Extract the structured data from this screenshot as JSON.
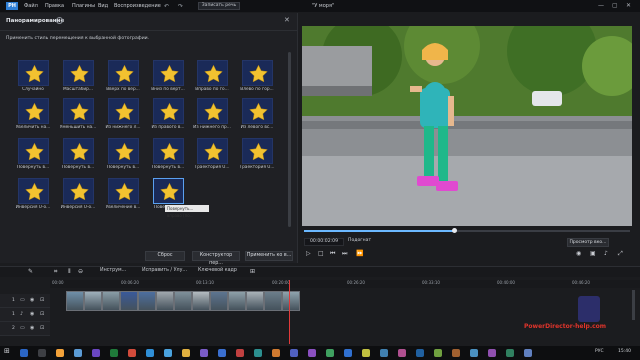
{
  "menu": [
    "Файл",
    "Правка",
    "Плагины",
    "Вид",
    "Воспроизведение"
  ],
  "record_btn": "Записать речь",
  "project_title": "\"У моря\"",
  "panel": {
    "title": "Панорамирование",
    "subtitle": "Применить стиль перемещения к выбранной фотографии.",
    "tooltip": "Повернуть... вправо (по...",
    "effects": [
      "Случайно",
      "Масштабир...",
      "Вверх по вер...",
      "Вниз по верт...",
      "Вправо по го...",
      "Влево по гор...",
      "Увеличить на...",
      "Уменьшить на...",
      "Из нижнего л...",
      "Из правого в...",
      "Из нижнего пр...",
      "Из левого вс...",
      "Повернуть в...",
      "Повернуть в...",
      "Повернуть в...",
      "Повернуть в...",
      "Траектория U...",
      "Траектория U...",
      "Инверсия U-о...",
      "Инверсия U-о...",
      "Увеличение в...",
      "Повернуть..."
    ],
    "buttons": {
      "reset": "Сброс",
      "constructor": "Конструктор пер...",
      "apply_all": "Применить ко в..."
    }
  },
  "preview": {
    "timecode": "00:00:02:09",
    "fit_label": "Подогнат",
    "snapshot_btn": "Просмотр вко..."
  },
  "toolbar": {
    "tools_label": "Инструм...",
    "fix_label": "Исправить / Улу...",
    "keyframe_label": "Ключевой кадр"
  },
  "ruler": [
    "00:00",
    "00:06:20",
    "00:13:10",
    "00:20:00",
    "00:26:20",
    "00:33:10",
    "00:40:00",
    "00:46:20"
  ],
  "tracks": [
    {
      "index": "1",
      "name": "video"
    },
    {
      "index": "1",
      "name": "audio"
    },
    {
      "index": "2",
      "name": "video"
    }
  ],
  "taskbar": {
    "lang": "РУС",
    "time": "15:40"
  },
  "watermark": "PowerDirector-help.com",
  "colors": {
    "accent": "#5aa0f0",
    "tile_bg": "#1a2a58",
    "star": "#f2c230",
    "playhead": "#e23a3a"
  }
}
